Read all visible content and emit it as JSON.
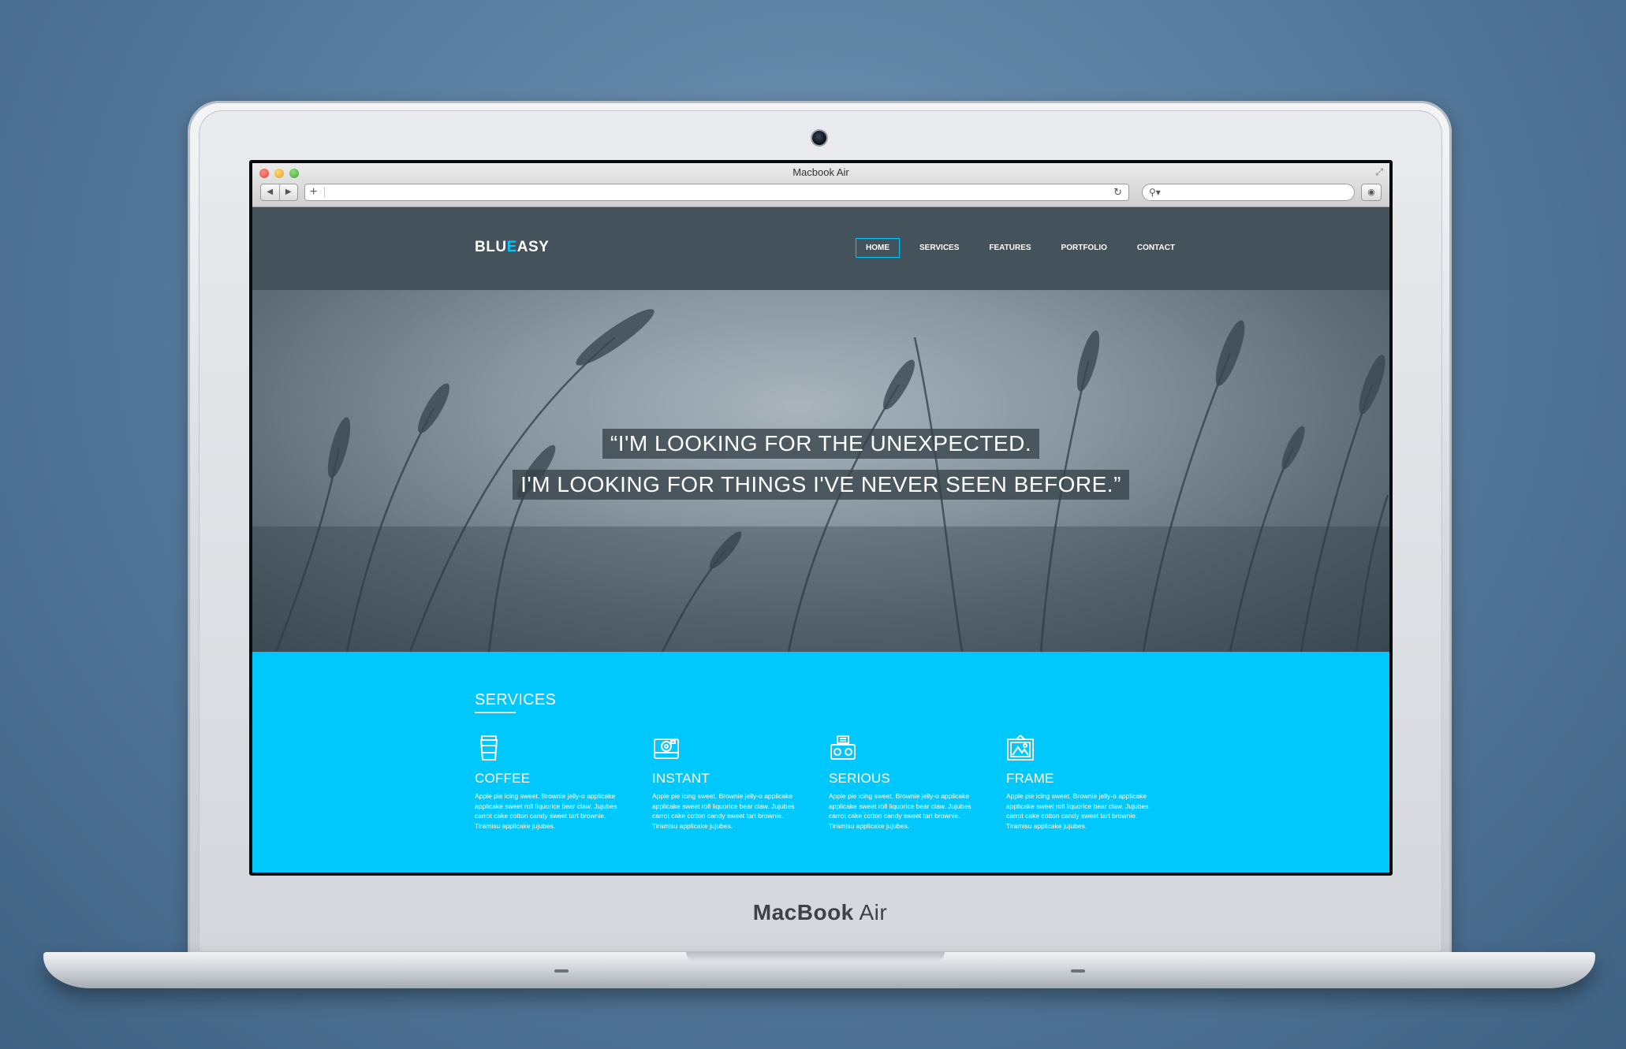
{
  "device": {
    "label_bold": "MacBook",
    "label_light": " Air"
  },
  "browser": {
    "window_title": "Macbook Air",
    "back_glyph": "◀",
    "forward_glyph": "▶",
    "add_tab_glyph": "+",
    "reload_glyph": "↻",
    "search_glyph": "⚲▾",
    "download_glyph": "◉",
    "resize_glyph": "⤢"
  },
  "site": {
    "logo_part1": "BLU",
    "logo_accent": "E",
    "logo_part2": "ASY",
    "accent_color": "#00c8fd",
    "header_color": "#43525b",
    "nav": [
      {
        "label": "HOME",
        "active": true
      },
      {
        "label": "SERVICES",
        "active": false
      },
      {
        "label": "FEATURES",
        "active": false
      },
      {
        "label": "PORTFOLIO",
        "active": false
      },
      {
        "label": "CONTACT",
        "active": false
      }
    ],
    "hero": {
      "quote_line1": "“I'M LOOKING FOR THE UNEXPECTED.",
      "quote_line2": "I'M LOOKING FOR THINGS I'VE NEVER SEEN BEFORE.”"
    },
    "services": {
      "title": "SERVICES",
      "items": [
        {
          "name": "COFFEE",
          "icon": "coffee-cup-icon",
          "desc": "Apple pie icing sweet. Brownie jelly-o applicake applicake sweet roll liquorice bear claw. Jujubes carrot cake cotton candy sweet tart brownie. Tiramisu applicake jujubes."
        },
        {
          "name": "INSTANT",
          "icon": "instant-camera-icon",
          "desc": "Apple pie icing sweet. Brownie jelly-o applicake applicake sweet roll liquorice bear claw. Jujubes carrot cake cotton candy sweet tart brownie. Tiramisu applicake jujubes."
        },
        {
          "name": "SERIOUS",
          "icon": "vintage-camera-icon",
          "desc": "Apple pie icing sweet. Brownie jelly-o applicake applicake sweet roll liquorice bear claw. Jujubes carrot cake cotton candy sweet tart brownie. Tiramisu applicake jujubes."
        },
        {
          "name": "FRAME",
          "icon": "picture-frame-icon",
          "desc": "Apple pie icing sweet. Brownie jelly-o applicake applicake sweet roll liquorice bear claw. Jujubes carrot cake cotton candy sweet tart brownie. Tiramisu applicake jujubes."
        }
      ]
    }
  }
}
